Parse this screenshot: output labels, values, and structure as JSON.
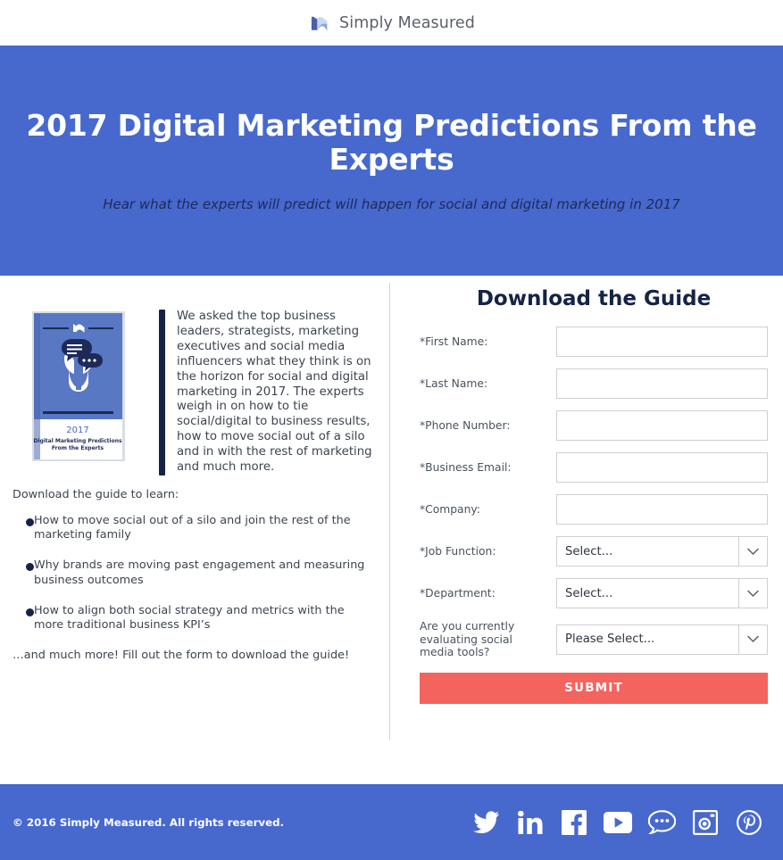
{
  "header": {
    "logo_icon": "simply-measured-logo-mark",
    "brand_name": "Simply Measured"
  },
  "hero": {
    "title": "2017 Digital Marketing Predictions From the Experts",
    "subtitle": "Hear what the experts will predict will happen for social and digital marketing in 2017",
    "background_color": "#4769ce",
    "title_color": "#ffffff",
    "subtitle_color": "#1d2a57"
  },
  "main": {
    "cover": {
      "alt": "ebook-cover",
      "year": "2017",
      "line1": "Digital Marketing Predictions",
      "line2": "From the Experts"
    },
    "intro_paragraph": "We asked the top business leaders, strategists, marketing executives and social media influencers what they think is on the horizon for social and digital marketing in 2017. The experts weigh in on how to tie social/digital to business results, how to move social out of a silo and in with the rest of marketing and much more.",
    "learn_heading": "Download the guide to learn:",
    "learn_items": [
      "How to move social out of a silo and join the rest of the marketing family",
      "Why brands are moving past engagement and measuring business outcomes",
      "How to align both social strategy and metrics with the more traditional business KPI’s"
    ],
    "closing_line": "…and much more! Fill out the form to download the guide!"
  },
  "form": {
    "title": "Download the Guide",
    "fields": [
      {
        "label": "First Name:",
        "required": true,
        "type": "text",
        "value": "",
        "placeholder": ""
      },
      {
        "label": "Last Name:",
        "required": true,
        "type": "text",
        "value": "",
        "placeholder": ""
      },
      {
        "label": "Phone Number:",
        "required": true,
        "type": "text",
        "value": "",
        "placeholder": ""
      },
      {
        "label": "Business Email:",
        "required": true,
        "type": "text",
        "value": "",
        "placeholder": ""
      },
      {
        "label": "Company:",
        "required": true,
        "type": "text",
        "value": "",
        "placeholder": ""
      },
      {
        "label": "Job Function:",
        "required": true,
        "type": "select",
        "value": "Select..."
      },
      {
        "label": "Department:",
        "required": true,
        "type": "select",
        "value": "Select..."
      },
      {
        "label": "Are you currently evaluating social media tools?",
        "required": false,
        "type": "select",
        "value": "Please Select..."
      }
    ],
    "required_marker": "*",
    "dropdown_icon": "chevron-down-icon",
    "submit_label": "SUBMIT",
    "submit_color": "#f4645f"
  },
  "footer": {
    "copyright": "© 2016 Simply Measured. All rights reserved.",
    "background_color": "#4769ce",
    "social": [
      {
        "name": "twitter-icon",
        "label": "Twitter"
      },
      {
        "name": "linkedin-icon",
        "label": "LinkedIn"
      },
      {
        "name": "facebook-icon",
        "label": "Facebook"
      },
      {
        "name": "youtube-icon",
        "label": "YouTube"
      },
      {
        "name": "blog-chat-icon",
        "label": "Blog"
      },
      {
        "name": "instagram-icon",
        "label": "Instagram"
      },
      {
        "name": "pinterest-icon",
        "label": "Pinterest"
      }
    ]
  }
}
